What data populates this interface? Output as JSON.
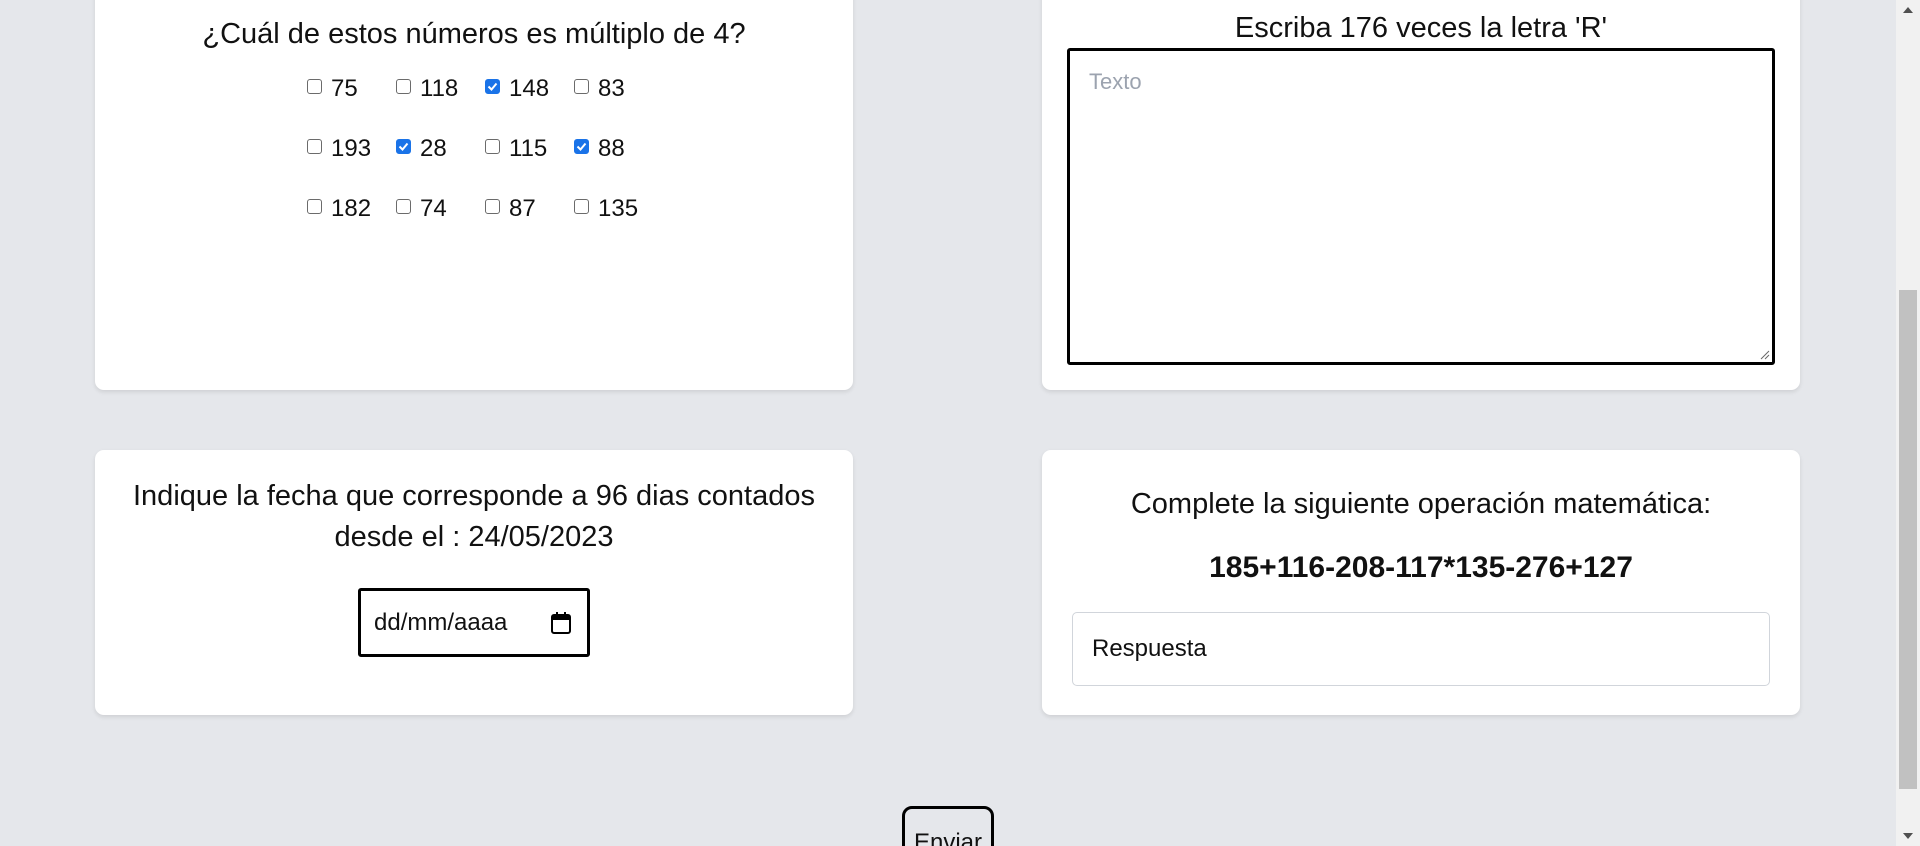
{
  "multiple_question": {
    "title": "¿Cuál de estos números es múltiplo de 4?",
    "options": [
      {
        "label": "75",
        "checked": false
      },
      {
        "label": "118",
        "checked": false
      },
      {
        "label": "148",
        "checked": true
      },
      {
        "label": "83",
        "checked": false
      },
      {
        "label": "193",
        "checked": false
      },
      {
        "label": "28",
        "checked": true
      },
      {
        "label": "115",
        "checked": false
      },
      {
        "label": "88",
        "checked": true
      },
      {
        "label": "182",
        "checked": false
      },
      {
        "label": "74",
        "checked": false
      },
      {
        "label": "87",
        "checked": false
      },
      {
        "label": "135",
        "checked": false
      }
    ]
  },
  "letter_question": {
    "title": "Escriba 176 veces la letra 'R'",
    "textarea_placeholder": "Texto",
    "textarea_value": ""
  },
  "date_question": {
    "title": "Indique la fecha que corresponde a 96 dias contados desde el : 24/05/2023",
    "date_placeholder": "dd/mm/aaaa"
  },
  "math_question": {
    "title": "Complete la siguiente operación matemática:",
    "expression": "185+116-208-117*135-276+127",
    "answer_placeholder": "Respuesta"
  },
  "submit": {
    "label": "Enviar"
  },
  "icons": {
    "calendar": "calendar-icon",
    "checkmark": "checkmark-icon",
    "resize": "resize-grip-icon"
  },
  "colors": {
    "page_background": "#e5e7eb",
    "card_background": "#ffffff",
    "checkbox_checked": "#1a73e8",
    "placeholder_text": "#9ca3af"
  }
}
